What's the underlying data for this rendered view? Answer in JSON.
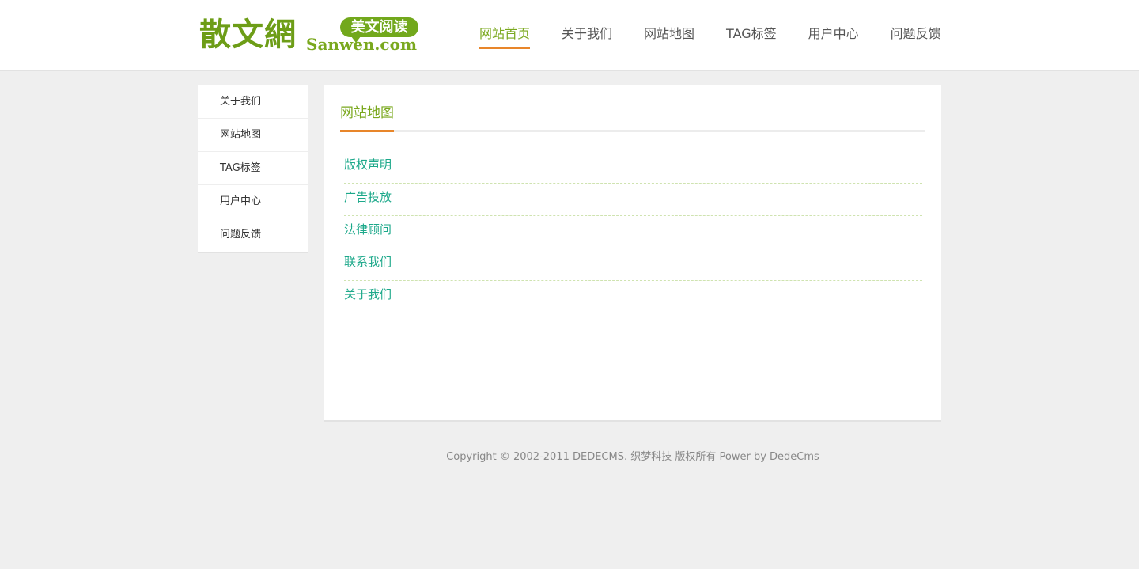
{
  "logo": {
    "main": "散文網",
    "badge": "美文阅读",
    "domain": "Sanwen.com"
  },
  "nav": {
    "items": [
      "网站首页",
      "关于我们",
      "网站地图",
      "TAG标签",
      "用户中心",
      "问题反馈"
    ],
    "active_index": 0
  },
  "sidebar": {
    "items": [
      "关于我们",
      "网站地图",
      "TAG标签",
      "用户中心",
      "问题反馈"
    ]
  },
  "main": {
    "title": "网站地图",
    "links": [
      "版权声明",
      "广告投放",
      "法律顾问",
      "联系我们",
      "关于我们"
    ]
  },
  "footer": {
    "text": "Copyright © 2002-2011 DEDECMS. 织梦科技 版权所有 Power by DedeCms"
  },
  "colors": {
    "brand_green": "#7aa81e",
    "accent_orange": "#e8862a",
    "link_teal": "#1ca88a",
    "page_bg": "#efefef"
  }
}
